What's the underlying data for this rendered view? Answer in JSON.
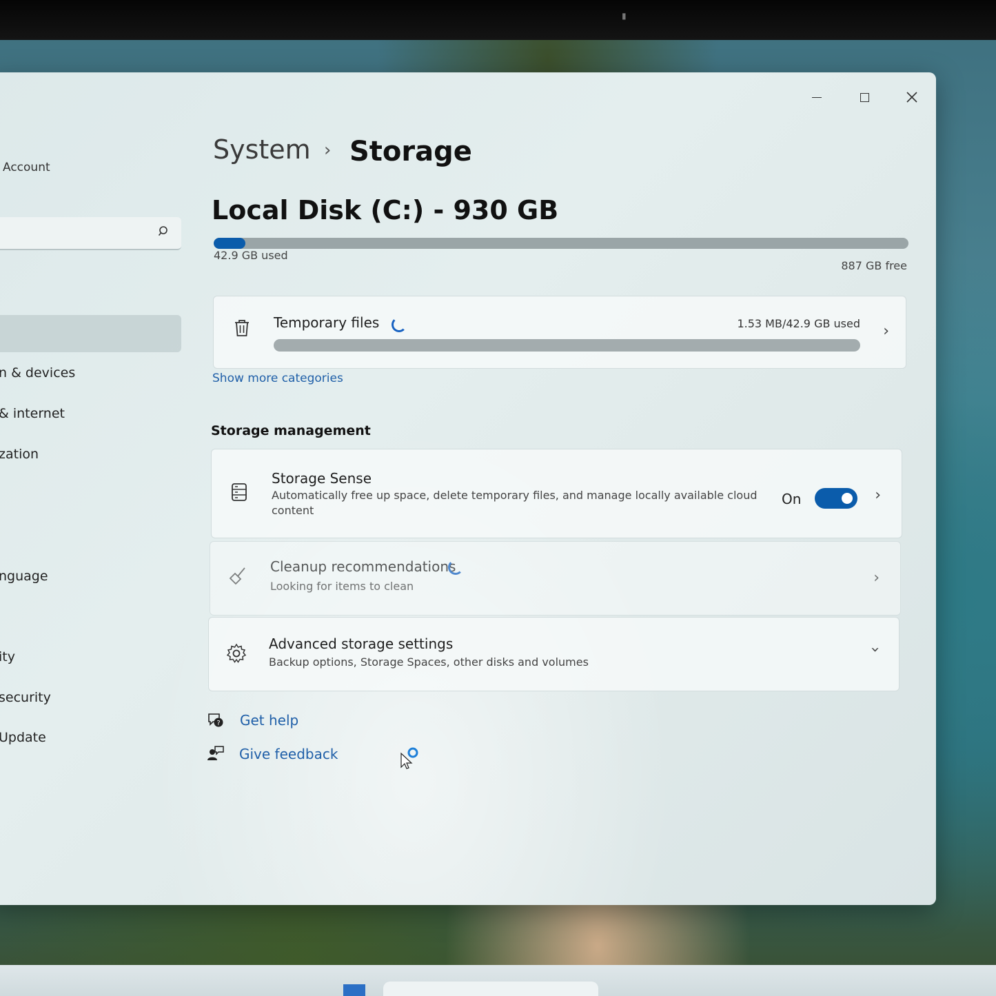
{
  "sidebar": {
    "account_label": "Account",
    "items": [
      {
        "label": "n & devices"
      },
      {
        "label": "& internet"
      },
      {
        "label": "zation"
      },
      {
        "label": "nguage"
      },
      {
        "label": "ity"
      },
      {
        "label": "security"
      },
      {
        "label": "Update"
      }
    ]
  },
  "breadcrumb": {
    "parent": "System",
    "separator": "›",
    "current": "Storage"
  },
  "disk": {
    "title": "Local Disk (C:) - 930 GB",
    "used_label": "42.9 GB used",
    "free_label": "887 GB free",
    "used_fraction": 0.046
  },
  "temporary_files": {
    "title": "Temporary files",
    "size_label": "1.53 MB/42.9 GB used",
    "icon": "trash-icon"
  },
  "show_more_label": "Show more categories",
  "storage_management": {
    "heading": "Storage management",
    "storage_sense": {
      "title": "Storage Sense",
      "description": "Automatically free up space, delete temporary files, and manage locally available cloud content",
      "toggle_label": "On",
      "toggle_on": true,
      "icon": "storage-icon"
    },
    "cleanup": {
      "title": "Cleanup recommendations",
      "description": "Looking for items to clean",
      "icon": "broom-icon"
    },
    "advanced": {
      "title": "Advanced storage settings",
      "description": "Backup options, Storage Spaces, other disks and volumes",
      "icon": "gear-icon"
    }
  },
  "links": {
    "get_help": "Get help",
    "give_feedback": "Give feedback"
  },
  "colors": {
    "accent": "#0b5cab",
    "link": "#1f5fa8"
  }
}
